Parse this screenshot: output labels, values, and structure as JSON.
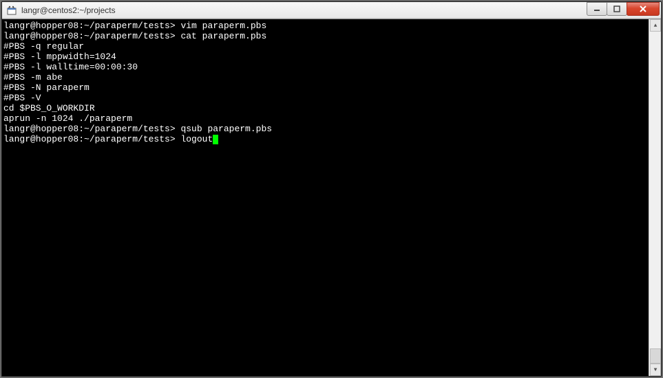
{
  "window": {
    "title": "langr@centos2:~/projects"
  },
  "terminal": {
    "lines": [
      {
        "prompt": "langr@hopper08:~/paraperm/tests>",
        "cmd": "vim paraperm.pbs"
      },
      {
        "prompt": "langr@hopper08:~/paraperm/tests>",
        "cmd": "cat paraperm.pbs"
      },
      {
        "text": "#PBS -q regular"
      },
      {
        "text": "#PBS -l mppwidth=1024"
      },
      {
        "text": "#PBS -l walltime=00:00:30"
      },
      {
        "text": "#PBS -m abe"
      },
      {
        "text": "#PBS -N paraperm"
      },
      {
        "text": "#PBS -V"
      },
      {
        "text": ""
      },
      {
        "text": "cd $PBS_O_WORKDIR"
      },
      {
        "text": "aprun -n 1024 ./paraperm"
      },
      {
        "text": ""
      },
      {
        "prompt": "langr@hopper08:~/paraperm/tests>",
        "cmd": "qsub paraperm.pbs"
      },
      {
        "text": ""
      },
      {
        "text": ""
      },
      {
        "text": ""
      },
      {
        "text": ""
      },
      {
        "text": ""
      },
      {
        "text": ""
      },
      {
        "prompt": "langr@hopper08:~/paraperm/tests>",
        "cmd": "logout",
        "cursor": true
      }
    ]
  }
}
